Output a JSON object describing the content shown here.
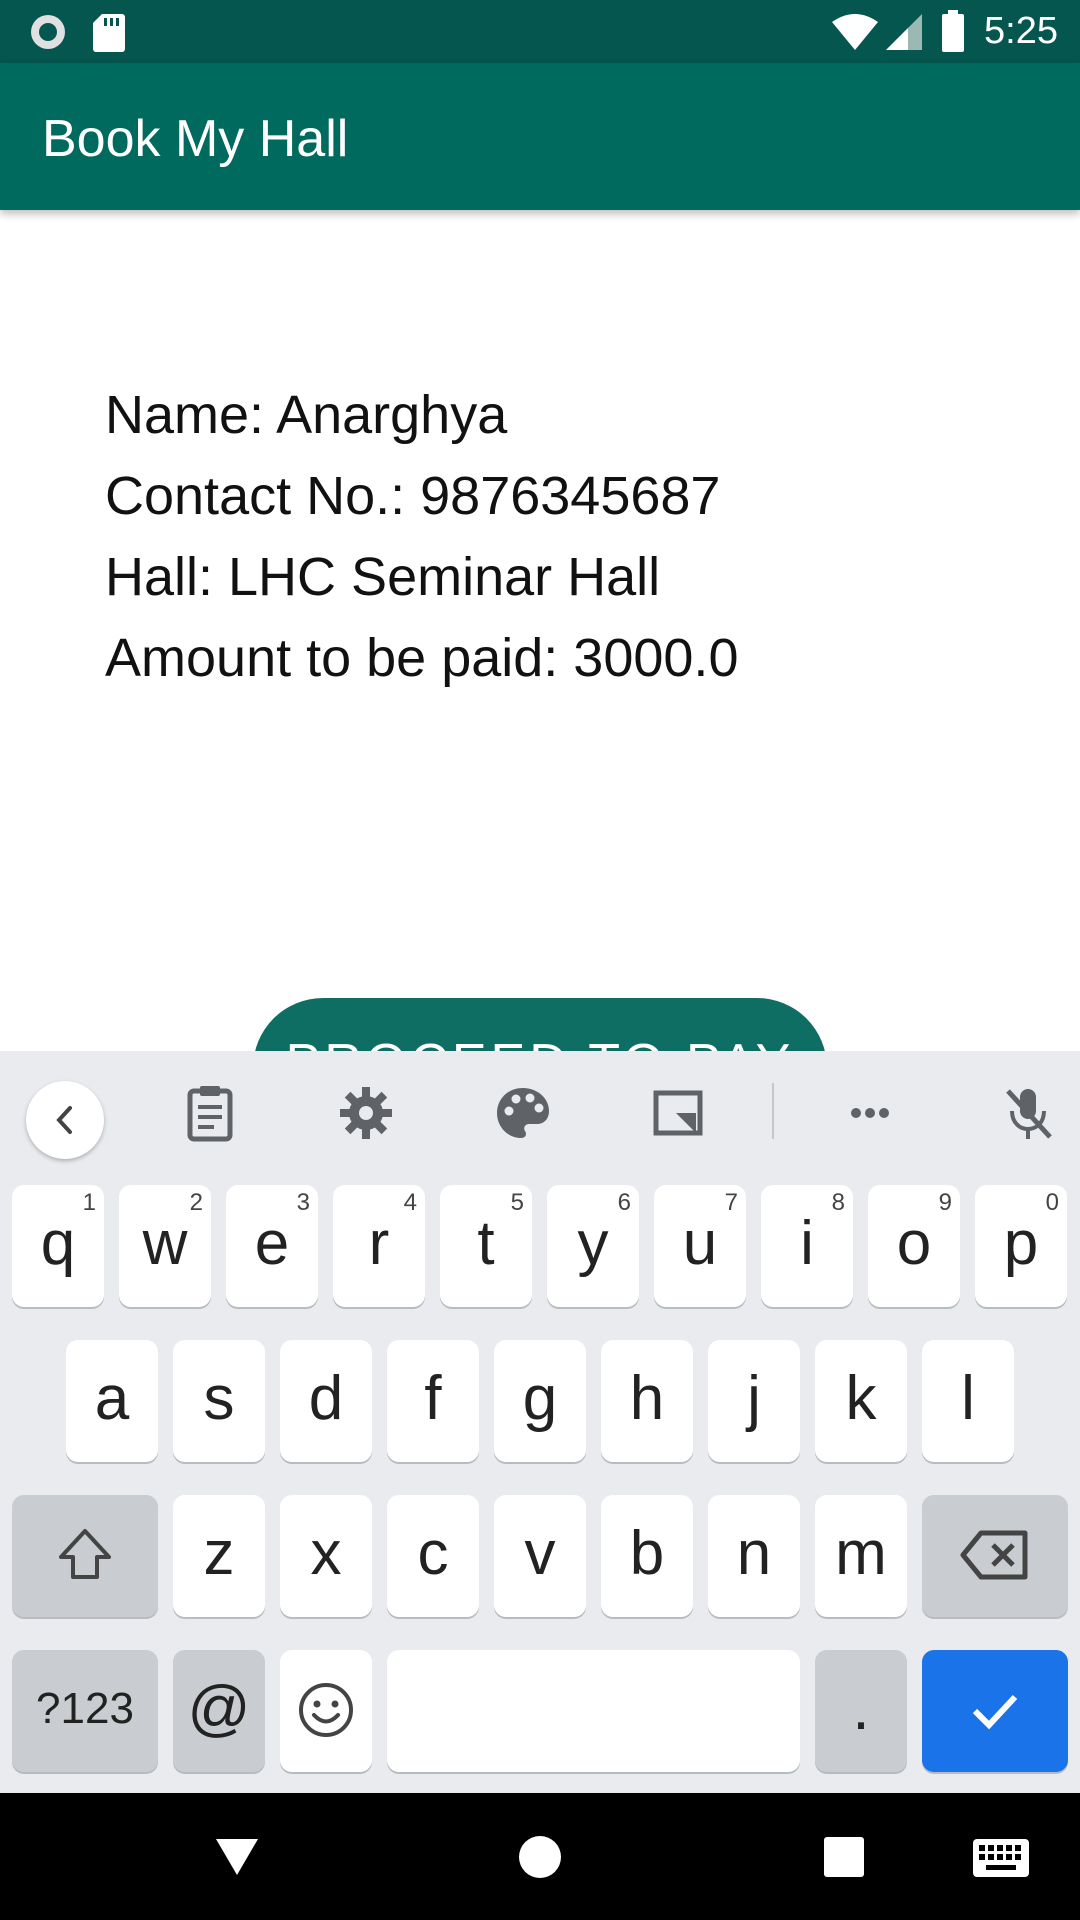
{
  "status_bar": {
    "time": "5:25"
  },
  "app_bar": {
    "title": "Book My Hall"
  },
  "booking": {
    "name": "Name: Anarghya",
    "contact": "Contact No.: 9876345687",
    "hall": "Hall: LHC Seminar Hall",
    "amount": "Amount to be paid: 3000.0"
  },
  "proceed_button": {
    "label": "PROCEED TO PAY"
  },
  "keyboard": {
    "row1": [
      {
        "letter": "q",
        "num": "1"
      },
      {
        "letter": "w",
        "num": "2"
      },
      {
        "letter": "e",
        "num": "3"
      },
      {
        "letter": "r",
        "num": "4"
      },
      {
        "letter": "t",
        "num": "5"
      },
      {
        "letter": "y",
        "num": "6"
      },
      {
        "letter": "u",
        "num": "7"
      },
      {
        "letter": "i",
        "num": "8"
      },
      {
        "letter": "o",
        "num": "9"
      },
      {
        "letter": "p",
        "num": "0"
      }
    ],
    "row2": [
      "a",
      "s",
      "d",
      "f",
      "g",
      "h",
      "j",
      "k",
      "l"
    ],
    "row3": [
      "z",
      "x",
      "c",
      "v",
      "b",
      "n",
      "m"
    ],
    "symbols_label": "?123",
    "at_label": "@",
    "period_label": "."
  },
  "colors": {
    "status_bar": "#05564f",
    "app_bar": "#006a5e",
    "button": "#0f6e63",
    "enter_key": "#1a73e8"
  }
}
